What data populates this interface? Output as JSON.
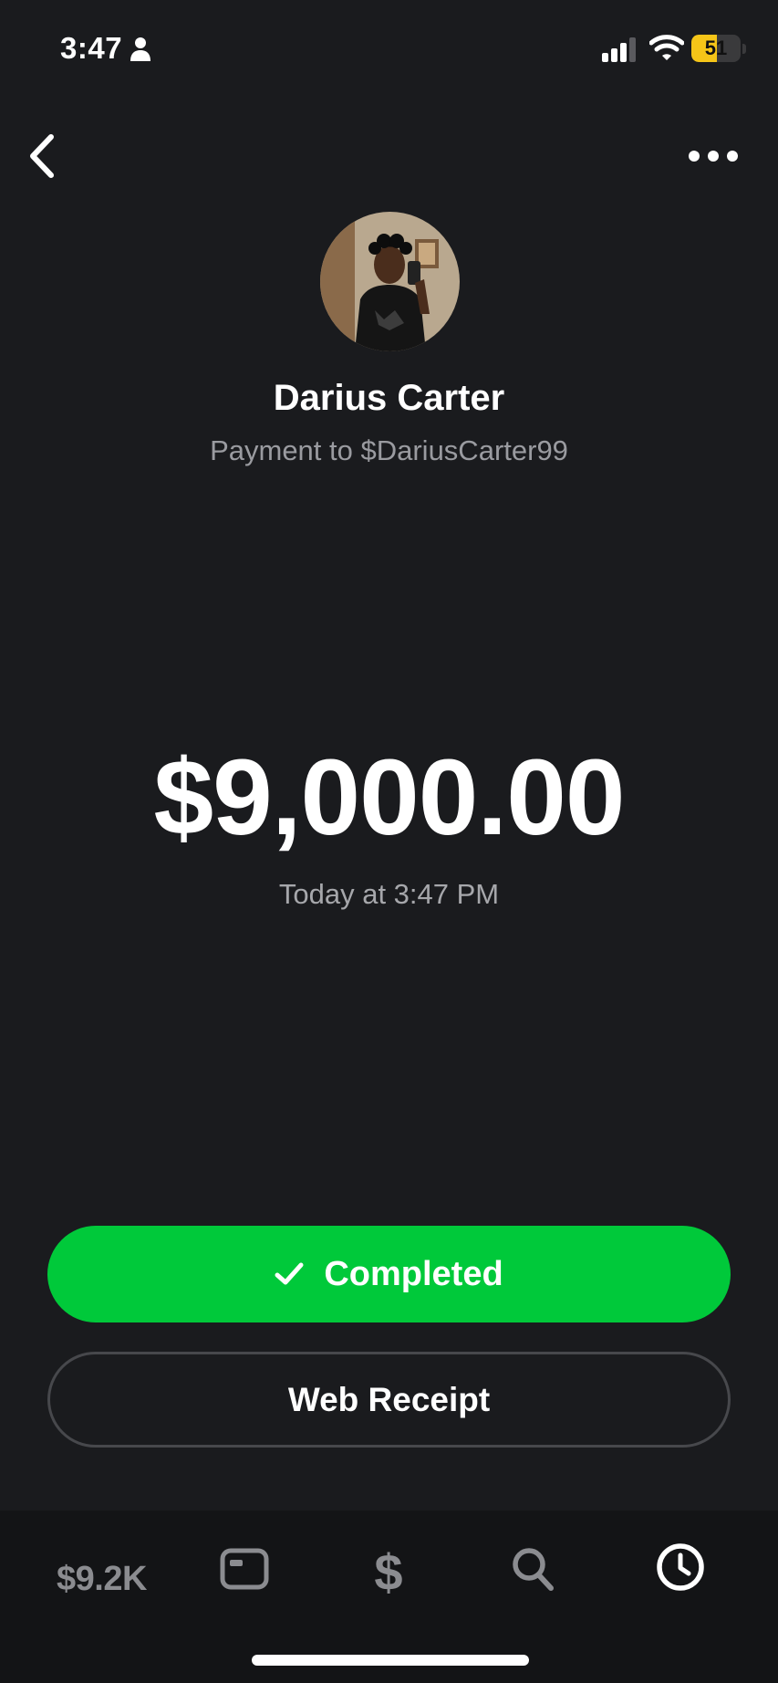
{
  "status_bar": {
    "time": "3:47",
    "battery_level": "51",
    "battery_fraction": 0.51,
    "battery_color": "#f5c518"
  },
  "header": {
    "back_icon": "chevron-left-icon",
    "more_icon": "more-horizontal-icon"
  },
  "recipient": {
    "name": "Darius Carter",
    "subtitle": "Payment to $DariusCarter99"
  },
  "payment": {
    "amount": "$9,000.00",
    "timestamp": "Today at 3:47 PM"
  },
  "actions": {
    "completed_label": "Completed",
    "completed_color": "#00c93a",
    "receipt_label": "Web Receipt"
  },
  "tab_bar": {
    "balance": "$9.2K",
    "card_icon": "card-icon",
    "dollar_glyph": "$",
    "search_icon": "search-icon",
    "activity_icon": "clock-icon"
  }
}
